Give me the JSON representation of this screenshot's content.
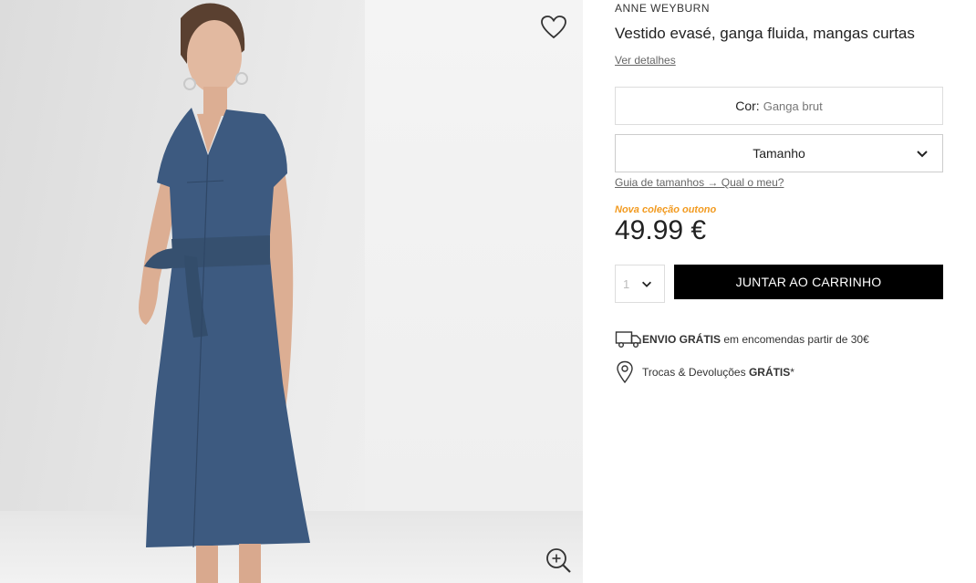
{
  "product": {
    "brand": "ANNE WEYBURN",
    "title": "Vestido evasé, ganga fluida, mangas curtas",
    "details_link": "Ver detalhes",
    "image_alt": "Modelo com vestido evasé de ganga"
  },
  "color": {
    "label": "Cor:",
    "value": "Ganga brut"
  },
  "size": {
    "label": "Tamanho",
    "guide_link": "Guia de tamanhos → Qual o meu?"
  },
  "pricing": {
    "promo": "Nova coleção outono",
    "price": "49.99 €"
  },
  "cart": {
    "quantity": "1",
    "add_label": "JUNTAR AO CARRINHO"
  },
  "perks": {
    "shipping_bold": "ENVIO GRÁTIS",
    "shipping_rest": " em encomendas partir de 30€",
    "returns_text": "Trocas & Devoluções ",
    "returns_bold": "GRÁTIS",
    "returns_suffix": "*"
  },
  "icons": {
    "wishlist": "heart-icon",
    "zoom": "zoom-in-icon",
    "size_dropdown": "chevron-down-icon",
    "shipping": "truck-icon",
    "returns": "location-pin-icon"
  },
  "colors": {
    "accent_promo": "#f29a1f",
    "button_bg": "#000000",
    "dress": "#3d5a80"
  }
}
